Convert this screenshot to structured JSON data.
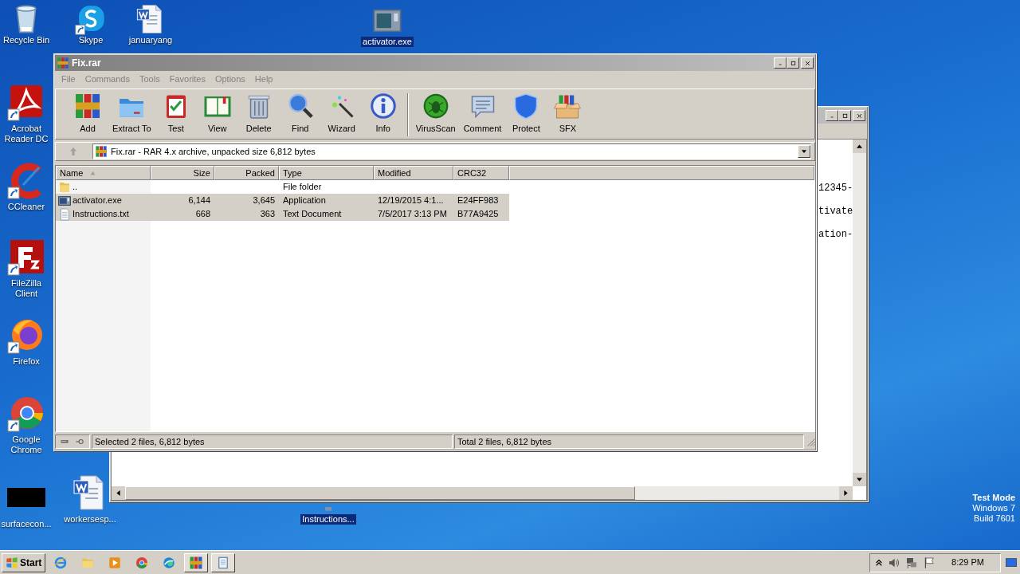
{
  "desktop_icons": [
    {
      "label": "Recycle Bin",
      "kind": "recycle",
      "selected": false
    },
    {
      "label": "Skype",
      "kind": "skype",
      "selected": false
    },
    {
      "label": "januaryang",
      "kind": "word",
      "selected": false
    },
    {
      "label": "activator.exe",
      "kind": "exe",
      "selected": true
    },
    {
      "label": "Acrobat Reader DC",
      "kind": "acrobat",
      "selected": false
    },
    {
      "label": "CCleaner",
      "kind": "ccleaner",
      "selected": false
    },
    {
      "label": "FileZilla Client",
      "kind": "filezilla",
      "selected": false
    },
    {
      "label": "Firefox",
      "kind": "firefox",
      "selected": false
    },
    {
      "label": "Google Chrome",
      "kind": "chrome",
      "selected": false
    },
    {
      "label": "surfacecon...",
      "kind": "black",
      "selected": false
    },
    {
      "label": "workersesp...",
      "kind": "word",
      "selected": false
    },
    {
      "label": "Instructions...",
      "kind": "text",
      "selected": true
    }
  ],
  "back_window": {
    "lines": [
      "12345-",
      "tivate",
      "ation-"
    ]
  },
  "window": {
    "title": "Fix.rar",
    "menu": [
      "File",
      "Commands",
      "Tools",
      "Favorites",
      "Options",
      "Help"
    ],
    "toolbar_groups": [
      {
        "buttons": [
          {
            "label": "Add",
            "kind": "add"
          },
          {
            "label": "Extract To",
            "kind": "extract"
          },
          {
            "label": "Test",
            "kind": "test"
          },
          {
            "label": "View",
            "kind": "view"
          },
          {
            "label": "Delete",
            "kind": "delete"
          },
          {
            "label": "Find",
            "kind": "find"
          },
          {
            "label": "Wizard",
            "kind": "wizard"
          },
          {
            "label": "Info",
            "kind": "info"
          }
        ]
      },
      {
        "buttons": [
          {
            "label": "VirusScan",
            "kind": "virus"
          },
          {
            "label": "Comment",
            "kind": "comment"
          },
          {
            "label": "Protect",
            "kind": "protect"
          },
          {
            "label": "SFX",
            "kind": "sfx"
          }
        ]
      }
    ],
    "address": "Fix.rar - RAR 4.x archive, unpacked size 6,812 bytes",
    "columns": [
      {
        "label": "Name",
        "sorted": true
      },
      {
        "label": "Size",
        "sorted": false
      },
      {
        "label": "Packed",
        "sorted": false
      },
      {
        "label": "Type",
        "sorted": false
      },
      {
        "label": "Modified",
        "sorted": false
      },
      {
        "label": "CRC32",
        "sorted": false
      }
    ],
    "rows": [
      {
        "kind": "folder",
        "selected": false,
        "cells": [
          "..",
          "",
          "",
          "File folder",
          "",
          ""
        ]
      },
      {
        "kind": "exe",
        "selected": true,
        "cells": [
          "activator.exe",
          "6,144",
          "3,645",
          "Application",
          "12/19/2015 4:1...",
          "E24FF983"
        ]
      },
      {
        "kind": "txt",
        "selected": true,
        "cells": [
          "Instructions.txt",
          "668",
          "363",
          "Text Document",
          "7/5/2017 3:13 PM",
          "B77A9425"
        ]
      }
    ],
    "status": [
      "Selected 2 files, 6,812 bytes",
      "Total 2 files, 6,812 bytes"
    ]
  },
  "os_notice": [
    "Test Mode",
    "Windows 7",
    "Build 7601"
  ],
  "taskbar": {
    "start": "Start",
    "apps": [
      {
        "kind": "ie",
        "running": false
      },
      {
        "kind": "explorer",
        "running": false
      },
      {
        "kind": "media",
        "running": false
      },
      {
        "kind": "chrome",
        "running": false
      },
      {
        "kind": "edge",
        "running": false
      },
      {
        "kind": "winrar",
        "running": true
      },
      {
        "kind": "notepad",
        "running": true
      }
    ],
    "clock": "8:29 PM"
  }
}
